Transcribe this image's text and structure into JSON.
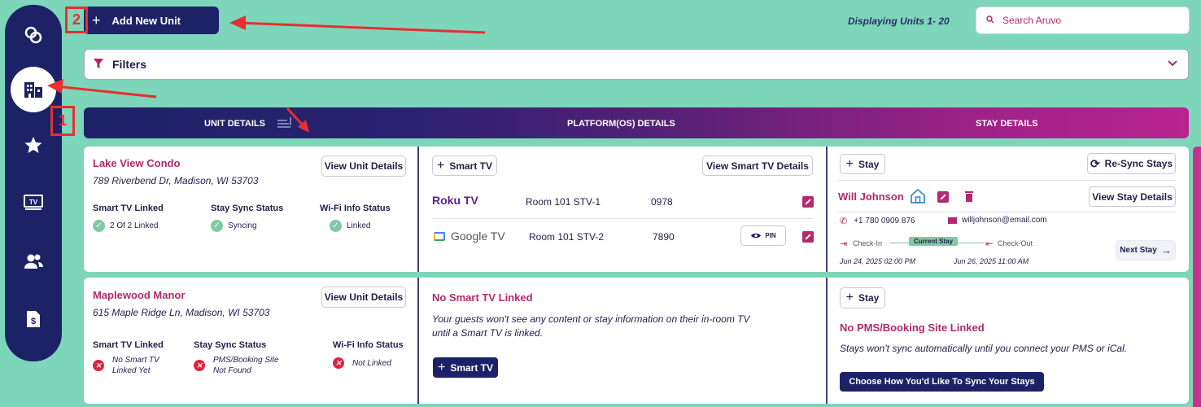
{
  "colors": {
    "brand_navy": "#1d2266",
    "accent_magenta": "#b2296e",
    "background": "#7dd6b9",
    "success": "#80c9a4",
    "error": "#e0243f"
  },
  "sidebar": {
    "items": [
      {
        "icon": "rings-icon"
      },
      {
        "icon": "building-icon",
        "active": true
      },
      {
        "icon": "star-icon"
      },
      {
        "icon": "tv-icon"
      },
      {
        "icon": "users-icon"
      },
      {
        "icon": "invoice-icon"
      }
    ]
  },
  "toolbar": {
    "add_unit_label": "Add New Unit",
    "displaying_label": "Displaying Units  1-  20"
  },
  "search": {
    "placeholder": "Search Aruvo"
  },
  "filters": {
    "label": "Filters"
  },
  "table_header": {
    "unit_details": "UNIT DETAILS",
    "platform_details": "PLATFORM(OS) DETAILS",
    "stay_details": "STAY DETAILS"
  },
  "annotations": {
    "box1": "1",
    "box2": "2"
  },
  "units": [
    {
      "name": "Lake View Condo",
      "address": "789 Riverbend Dr, Madison, WI 53703",
      "view_btn": "View Unit Details",
      "stats": [
        {
          "label": "Smart TV Linked",
          "value": "2 Of 2 Linked"
        },
        {
          "label": "Stay Sync Status",
          "value": "Syncing"
        },
        {
          "label": "Wi-Fi Info Status",
          "value": "Linked"
        }
      ],
      "platform": {
        "add_tv": "Smart TV",
        "view_tv_btn": "View Smart TV Details",
        "tvs": [
          {
            "brand": "Roku TV",
            "room": "Room 101 STV-1",
            "code": "0978"
          },
          {
            "brand": "Google TV",
            "room": "Room 101 STV-2",
            "code": "7890",
            "pin_label": "PIN"
          }
        ]
      },
      "stay": {
        "add_stay": "Stay",
        "resync": "Re-Sync Stays",
        "guest": "Will Johnson",
        "view_stay_btn": "View Stay Details",
        "phone": "+1 780 0909 876",
        "email": "willjohnson@email.com",
        "check_in_label": "Check-In",
        "current_stay": "Current Stay",
        "check_out_label": "Check-Out",
        "check_in_date": "Jun 24, 2025  02:00 PM",
        "check_out_date": "Jun 26, 2025 11:00 AM",
        "next_stay": "Next Stay"
      }
    },
    {
      "name": "Maplewood Manor",
      "address": "615 Maple Ridge Ln, Madison, WI 53703",
      "view_btn": "View Unit Details",
      "stats": [
        {
          "label": "Smart TV Linked",
          "value_1": "No Smart TV",
          "value_2": "Linked Yet"
        },
        {
          "label": "Stay Sync Status",
          "value_1": "PMS/Booking Site",
          "value_2": "Not Found"
        },
        {
          "label": "Wi-Fi Info Status",
          "value": "Not Linked"
        }
      ],
      "platform": {
        "heading": "No Smart TV Linked",
        "text_1": "Your guests won't see any content or stay information on their in-room TV",
        "text_2": "until a Smart TV is linked.",
        "add_tv": "Smart TV"
      },
      "stay": {
        "add_stay": "Stay",
        "heading": "No PMS/Booking Site Linked",
        "text": "Stays won't sync automatically until you connect your PMS or iCal.",
        "choose_btn": "Choose How You'd Like To Sync Your Stays"
      }
    }
  ]
}
